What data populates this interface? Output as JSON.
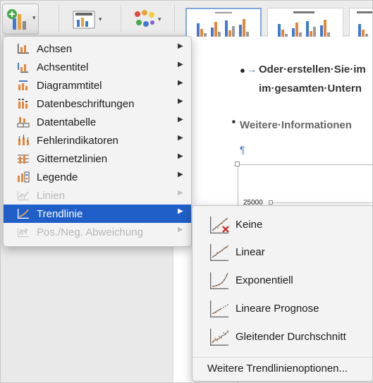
{
  "ribbon": {
    "add_chart_element_icon": "chart-add-icon",
    "quick_layout_icon": "chart-layout-icon",
    "change_colors_icon": "color-dots-icon",
    "dropdown_glyph": "▾"
  },
  "document": {
    "line1": "Oder·erstellen·Sie·im",
    "line2": "im·gesamten·Untern",
    "line3": "Weitere·Informationen",
    "pilcrow": "¶",
    "axis_tick": "25000"
  },
  "menu": {
    "items": [
      {
        "label": "Achsen",
        "icon": "axes-icon",
        "disabled": false,
        "active": false
      },
      {
        "label": "Achsentitel",
        "icon": "axis-title-icon",
        "disabled": false,
        "active": false
      },
      {
        "label": "Diagrammtitel",
        "icon": "chart-title-icon",
        "disabled": false,
        "active": false
      },
      {
        "label": "Datenbeschriftungen",
        "icon": "data-labels-icon",
        "disabled": false,
        "active": false
      },
      {
        "label": "Datentabelle",
        "icon": "data-table-icon",
        "disabled": false,
        "active": false
      },
      {
        "label": "Fehlerindikatoren",
        "icon": "error-bars-icon",
        "disabled": false,
        "active": false
      },
      {
        "label": "Gitternetzlinien",
        "icon": "gridlines-icon",
        "disabled": false,
        "active": false
      },
      {
        "label": "Legende",
        "icon": "legend-icon",
        "disabled": false,
        "active": false
      },
      {
        "label": "Linien",
        "icon": "lines-icon",
        "disabled": true,
        "active": false
      },
      {
        "label": "Trendlinie",
        "icon": "trendline-icon",
        "disabled": false,
        "active": true
      },
      {
        "label": "Pos./Neg. Abweichung",
        "icon": "up-down-bars-icon",
        "disabled": true,
        "active": false
      }
    ],
    "arrow_glyph": "▶"
  },
  "submenu": {
    "items": [
      {
        "label": "Keine",
        "icon": "trendline-none-icon"
      },
      {
        "label": "Linear",
        "icon": "trendline-linear-icon"
      },
      {
        "label": "Exponentiell",
        "icon": "trendline-exponential-icon"
      },
      {
        "label": "Lineare Prognose",
        "icon": "trendline-linear-forecast-icon"
      },
      {
        "label": "Gleitender Durchschnitt",
        "icon": "trendline-moving-average-icon"
      }
    ],
    "more_options": "Weitere Trendlinienoptionen..."
  },
  "colors": {
    "highlight": "#1f5fc7",
    "accent_blue": "#4a7fc9",
    "accent_orange": "#e4873b",
    "delete_red": "#d0302b"
  }
}
